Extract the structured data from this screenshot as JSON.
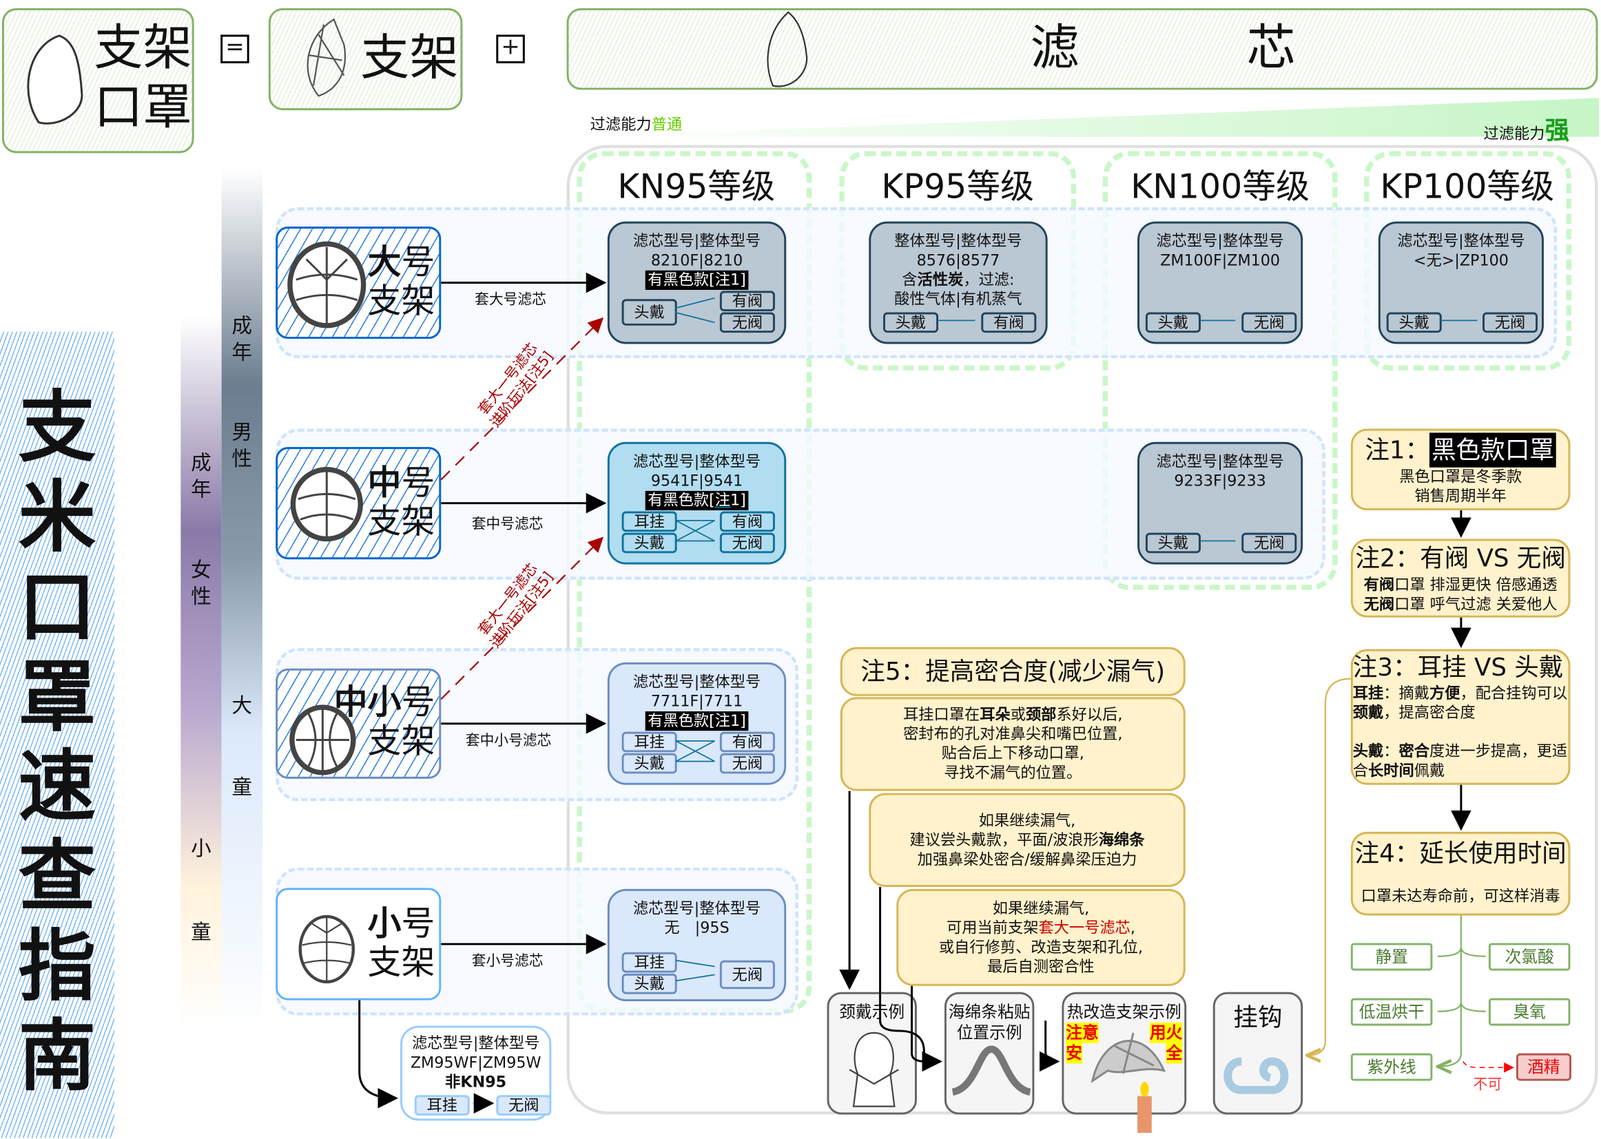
{
  "header": {
    "mask_label": [
      "支架",
      "口罩"
    ],
    "equals": "=",
    "frame_label": "支架",
    "plus": "+",
    "filter_label": [
      "滤",
      "芯"
    ],
    "filter_ability_low_prefix": "过滤能力",
    "filter_ability_low": "普通",
    "filter_ability_high_prefix": "过滤能力",
    "filter_ability_high": "强",
    "colors": {
      "green_border": "#82b366",
      "low": "#66cc00",
      "high": "#1a9e1a"
    }
  },
  "title": "支米口罩速查指南",
  "age_bars": {
    "left": [
      "成年",
      "女性",
      "小",
      "童"
    ],
    "right": [
      "成年",
      "男性",
      "大",
      "童"
    ]
  },
  "columns": [
    "KN95等级",
    "KP95等级",
    "KN100等级",
    "KP100等级"
  ],
  "frames": [
    {
      "bold": "大",
      "rest": "号",
      "line2": "支架",
      "arrow_label": "套大号滤芯"
    },
    {
      "bold": "中",
      "rest": "号",
      "line2": "支架",
      "arrow_label": "套中号滤芯"
    },
    {
      "bold": "中小",
      "rest": "号",
      "line2": "支架",
      "arrow_label": "套中小号滤芯"
    },
    {
      "bold": "小",
      "rest": "号",
      "line2": "支架",
      "arrow_label": "套小号滤芯"
    }
  ],
  "upgrade_label": [
    "套大一号滤芯",
    "进阶玩法[注5]"
  ],
  "filters": {
    "r1_kn95": {
      "title": "滤芯型号|整体型号",
      "model": "8210F|8210",
      "tag": "有黑色款[注1]",
      "wear": [
        "头戴"
      ],
      "valve": [
        "有阀",
        "无阀"
      ]
    },
    "r1_kp95": {
      "title": "整体型号|整体型号",
      "model": "8576|8577",
      "note_pre": "含",
      "note_bold": "活性炭",
      "note_post": "，过滤:",
      "note2": "酸性气体|有机蒸气",
      "wear": [
        "头戴"
      ],
      "valve": [
        "有阀"
      ]
    },
    "r1_kn100": {
      "title": "滤芯型号|整体型号",
      "model": "ZM100F|ZM100",
      "wear": [
        "头戴"
      ],
      "valve": [
        "无阀"
      ]
    },
    "r1_kp100": {
      "title": "滤芯型号|整体型号",
      "model": "<无>|ZP100",
      "wear": [
        "头戴"
      ],
      "valve": [
        "无阀"
      ]
    },
    "r2_kn95": {
      "title": "滤芯型号|整体型号",
      "model": "9541F|9541",
      "tag": "有黑色款[注1]",
      "wear": [
        "耳挂",
        "头戴"
      ],
      "valve": [
        "有阀",
        "无阀"
      ]
    },
    "r2_kn100": {
      "title": "滤芯型号|整体型号",
      "model": "9233F|9233",
      "wear": [
        "头戴"
      ],
      "valve": [
        "无阀"
      ]
    },
    "r3_kn95": {
      "title": "滤芯型号|整体型号",
      "model": "7711F|7711",
      "tag": "有黑色款[注1]",
      "wear": [
        "耳挂",
        "头戴"
      ],
      "valve": [
        "有阀",
        "无阀"
      ]
    },
    "r4_kn95": {
      "title": "滤芯型号|整体型号",
      "model": "无　|95S",
      "wear": [
        "耳挂",
        "头戴"
      ],
      "valve": [
        "无阀"
      ]
    },
    "non_kn95": {
      "title": "滤芯型号|整体型号",
      "model": "ZM95WF|ZM95W",
      "tag": "非KN95",
      "wear": [
        "耳挂"
      ],
      "valve": [
        "无阀"
      ]
    }
  },
  "notes": {
    "n1": {
      "head": "注1：",
      "head_tag": "黑色款口罩",
      "lines": [
        "黑色口罩是冬季款",
        "销售周期半年"
      ]
    },
    "n2": {
      "head": "注2：有阀 VS 无阀",
      "l1_b": "有阀",
      "l1": "口罩 排湿更快 倍感通透",
      "l2_b": "无阀",
      "l2": "口罩 呼气过滤 关爱他人"
    },
    "n3": {
      "head": "注3：耳挂 VS 头戴",
      "p1_b1": "耳挂",
      "p1_a": "：摘戴",
      "p1_b2": "方便",
      "p1_c": "，配合挂钩可以",
      "p1_b3": "颈戴",
      "p1_d": "，提高密合度",
      "p2_b1": "头戴",
      "p2_a": "：",
      "p2_b2": "密合",
      "p2_c": "度进一步提高，更适合",
      "p2_b3": "长时间",
      "p2_d": "佩戴"
    },
    "n4": {
      "head": "注4：延长使用时间",
      "body": "口罩未达寿命前，可这样消毒"
    },
    "disinfect": [
      "静置",
      "次氯酸",
      "低温烘干",
      "臭氧",
      "紫外线",
      "酒精"
    ],
    "not_allowed": "不可",
    "n5": {
      "head": "注5：提高密合度(减少漏气)",
      "b1_a": "耳挂口罩在",
      "b1_b1": "耳朵",
      "b1_c": "或",
      "b1_b2": "颈部",
      "b1_d": "系好以后,",
      "b1_lines": [
        "密封布的孔对准鼻尖和嘴巴位置,",
        "贴合后上下移动口罩,",
        "寻找不漏气的位置。"
      ],
      "b2_l1": "如果继续漏气,",
      "b2_l2": "建议尝头戴款，平面/波浪形",
      "b2_l2_b": "海绵条",
      "b2_l3": "加强鼻梁处密合/缓解鼻梁压迫力",
      "b3_l1": "如果继续漏气,",
      "b3_l2a": "可用当前支架",
      "b3_l2_red": "套大一号滤芯",
      "b3_l2b": ",",
      "b3_l3": "或自行修剪、改造支架和孔位,",
      "b3_l4": "最后自测密合性"
    },
    "examples": {
      "neck": "颈戴示例",
      "sponge": "海绵条粘贴位置示例",
      "heat": "热改造支架示例",
      "warn": [
        "注意",
        "用火",
        "安",
        "全"
      ],
      "hook": "挂钩"
    }
  }
}
